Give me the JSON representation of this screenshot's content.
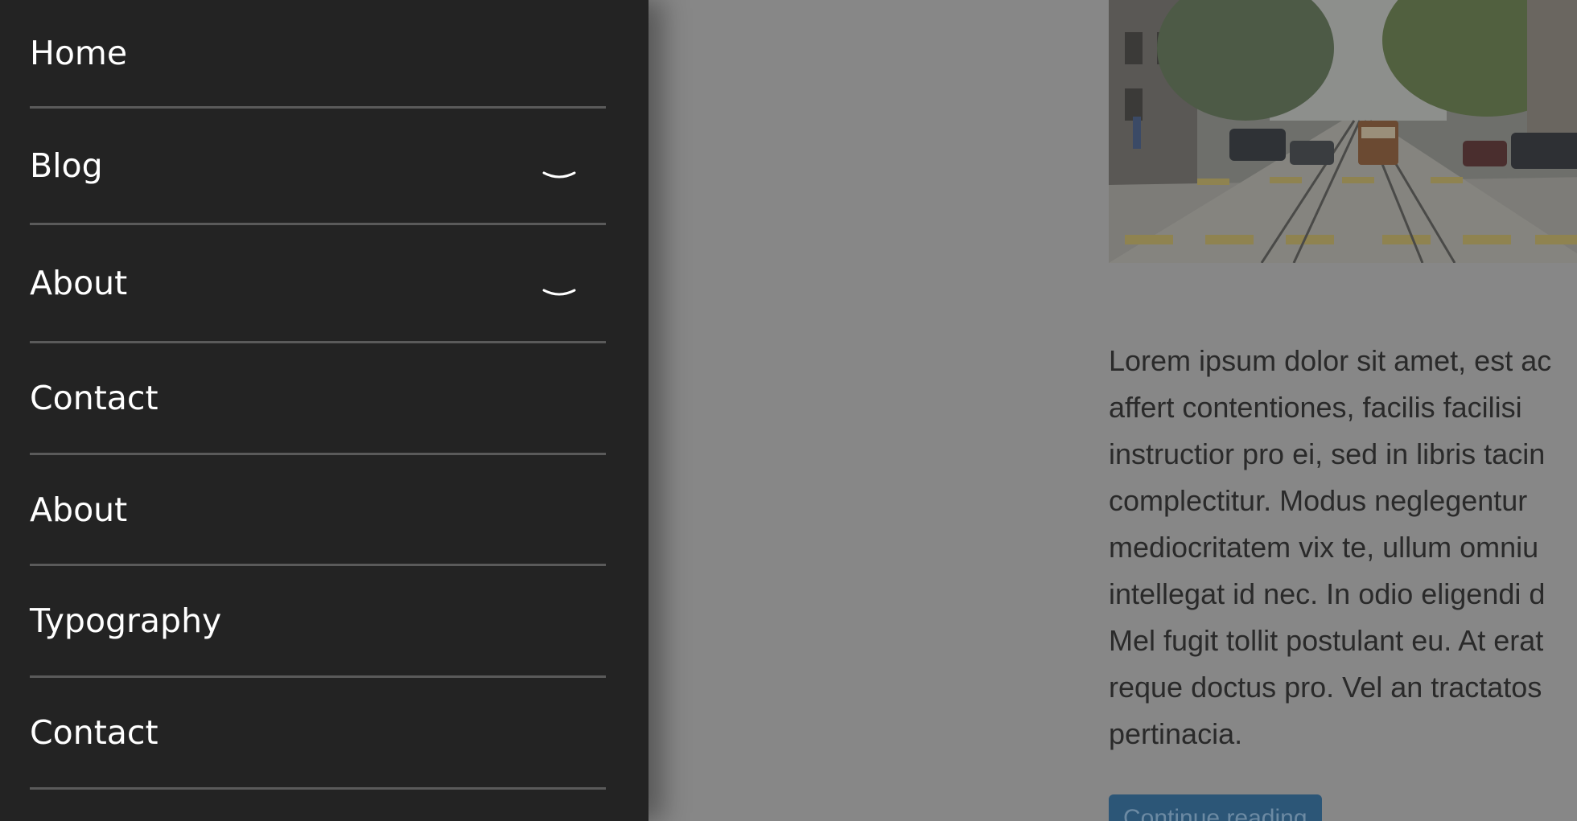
{
  "drawer": {
    "items": [
      {
        "label": "Home",
        "has_submenu": false
      },
      {
        "label": "Blog",
        "has_submenu": true
      },
      {
        "label": "About",
        "has_submenu": true
      },
      {
        "label": "Contact",
        "has_submenu": false
      },
      {
        "label": "About",
        "has_submenu": false
      },
      {
        "label": "Typography",
        "has_submenu": false
      },
      {
        "label": "Contact",
        "has_submenu": false
      }
    ],
    "chevron_icon": "chevron-down-icon"
  },
  "post": {
    "excerpt": "Lorem ipsum dolor sit amet, est ac\naffert contentiones, facilis facilisi\ninstructior pro ei, sed in libris tacin\ncomplectitur. Modus neglegentur\nmediocritatem vix te, ullum omniu\nintellegat id nec. In odio eligendi d\nMel fugit tollit postulant eu. At erat\nreque doctus pro. Vel an tractatos\npertinacia.",
    "read_more_label": "Continue reading"
  },
  "colors": {
    "drawer_bg": "#232323",
    "page_bg": "#878787",
    "button_bg": "#2c5677"
  }
}
